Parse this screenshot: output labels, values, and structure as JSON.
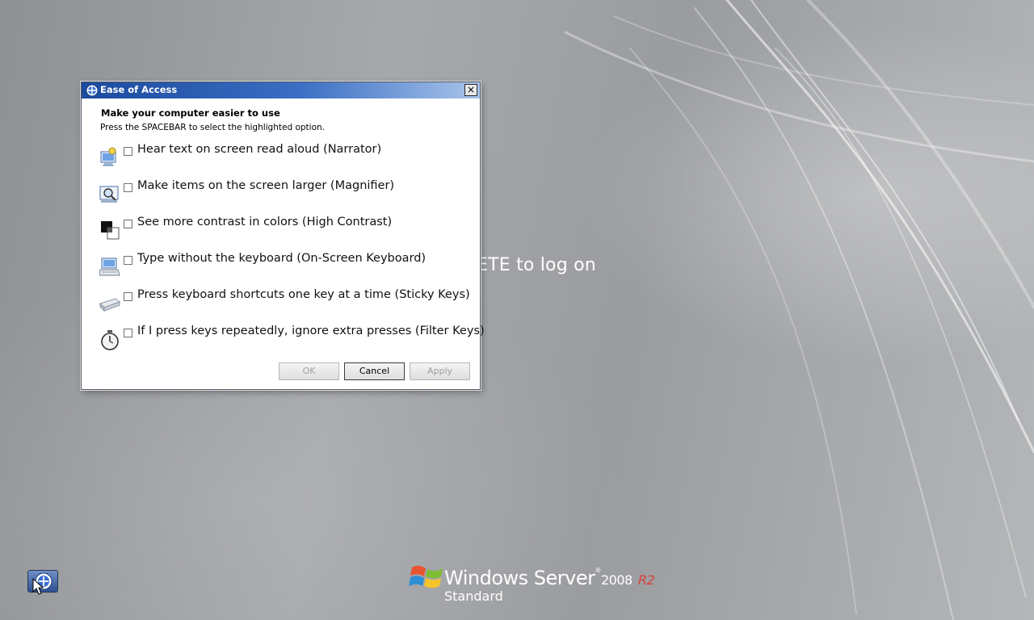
{
  "desktop": {
    "logon_message": "ALT + DELETE to log on"
  },
  "dialog": {
    "title": "Ease of Access",
    "close_glyph": "×",
    "heading": "Make your computer easier to use",
    "subheading": "Press the SPACEBAR to select the highlighted option.",
    "options": [
      {
        "label": "Hear text on screen read aloud (Narrator)",
        "checked": false,
        "icon": "narrator-icon"
      },
      {
        "label": "Make items on the screen larger (Magnifier)",
        "checked": false,
        "icon": "magnifier-icon"
      },
      {
        "label": "See more contrast in colors (High Contrast)",
        "checked": false,
        "icon": "high-contrast-icon"
      },
      {
        "label": "Type without the keyboard (On-Screen Keyboard)",
        "checked": false,
        "icon": "keyboard-icon"
      },
      {
        "label": "Press keyboard shortcuts one key at a time (Sticky Keys)",
        "checked": false,
        "icon": "sticky-keys-icon"
      },
      {
        "label": "If I press keys repeatedly, ignore extra presses (Filter Keys)",
        "checked": false,
        "icon": "stopwatch-icon"
      }
    ],
    "buttons": {
      "ok": "OK",
      "cancel": "Cancel",
      "apply": "Apply"
    }
  },
  "branding": {
    "product": "Windows Server",
    "trademark": "®",
    "year": "2008",
    "release": "R2",
    "edition": "Standard"
  },
  "colors": {
    "titlebar_start": "#1b4a9e",
    "titlebar_end": "#a8c4ea",
    "r2_accent": "#d8423b"
  }
}
